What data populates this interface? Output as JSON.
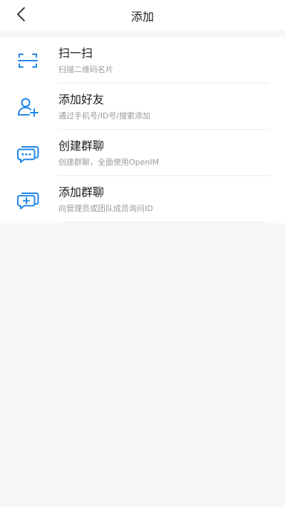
{
  "header": {
    "title": "添加"
  },
  "accent_color": "#1d86e8",
  "items": [
    {
      "label": "扫一扫",
      "subtitle": "扫描二维码名片",
      "icon": "scan-icon"
    },
    {
      "label": "添加好友",
      "subtitle": "通过手机号/ID号/搜索添加",
      "icon": "add-friend-icon"
    },
    {
      "label": "创建群聊",
      "subtitle": "创建群聊，全面使用OpenIM",
      "icon": "create-group-chat-icon"
    },
    {
      "label": "添加群聊",
      "subtitle": "向管理员或团队成员询问ID",
      "icon": "add-group-chat-icon"
    }
  ]
}
